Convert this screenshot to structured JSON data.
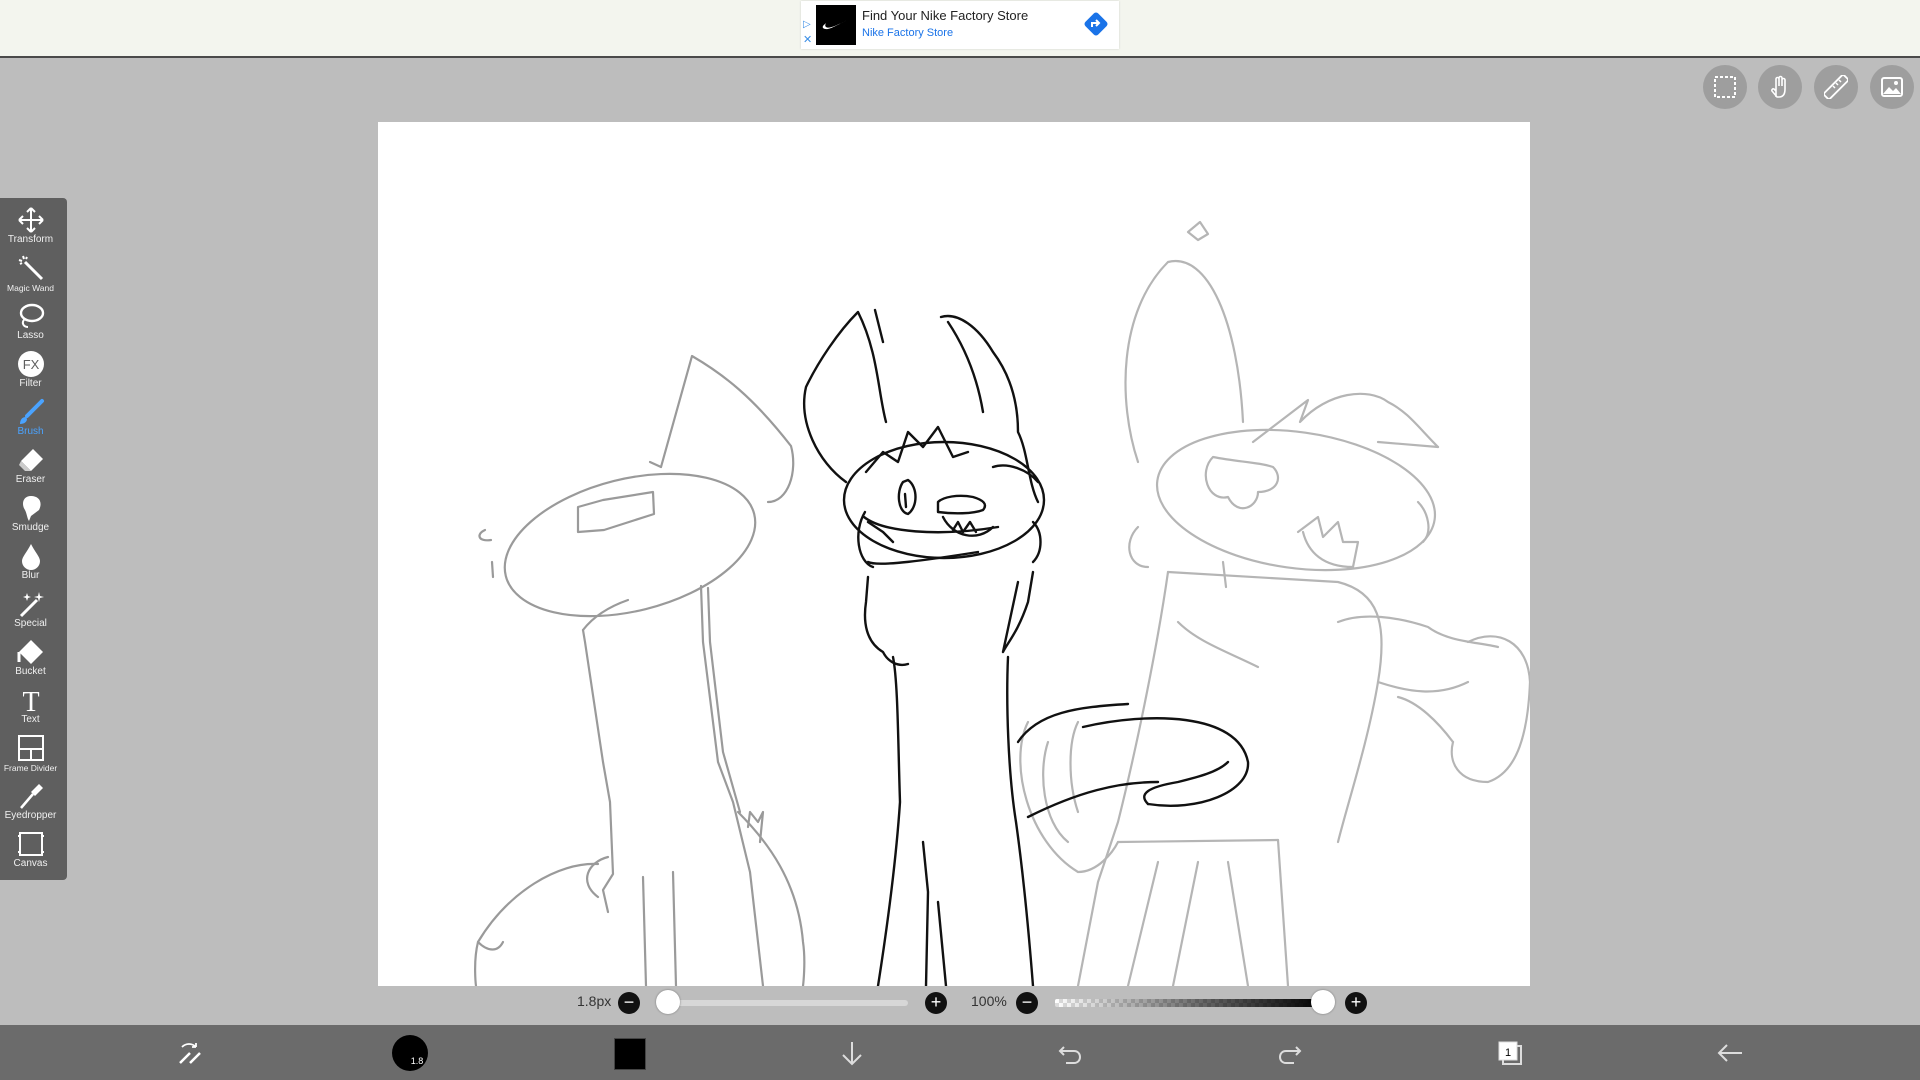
{
  "ad": {
    "title": "Find Your Nike Factory Store",
    "subtitle": "Nike Factory Store",
    "adchoices_icon": "adchoices-icon",
    "close_icon": "close-icon"
  },
  "top_right_tools": [
    {
      "name": "selection-icon"
    },
    {
      "name": "hand-icon"
    },
    {
      "name": "ruler-icon"
    },
    {
      "name": "image-icon"
    }
  ],
  "toolbar": {
    "active": "Brush",
    "accent": "#4aa3ff",
    "items": [
      {
        "label": "Transform"
      },
      {
        "label": "Magic Wand"
      },
      {
        "label": "Lasso"
      },
      {
        "label": "Filter",
        "icon_text": "FX"
      },
      {
        "label": "Brush"
      },
      {
        "label": "Eraser"
      },
      {
        "label": "Smudge"
      },
      {
        "label": "Blur"
      },
      {
        "label": "Special"
      },
      {
        "label": "Bucket"
      },
      {
        "label": "Text",
        "icon_text": "T"
      },
      {
        "label": "Frame Divider"
      },
      {
        "label": "Eyedropper"
      },
      {
        "label": "Canvas"
      }
    ]
  },
  "brush_size": {
    "label": "1.8px",
    "value_fraction": 0.0
  },
  "opacity": {
    "label": "100%",
    "value_percent": 100
  },
  "bottom_bar": {
    "brush_badge": "1.8",
    "color": "#000000",
    "layer_count": "1",
    "icons": [
      "brush-swap-icon",
      "brush-size-icon",
      "color-swatch",
      "download-icon",
      "undo-icon",
      "redo-icon",
      "layers-icon",
      "back-icon"
    ]
  }
}
